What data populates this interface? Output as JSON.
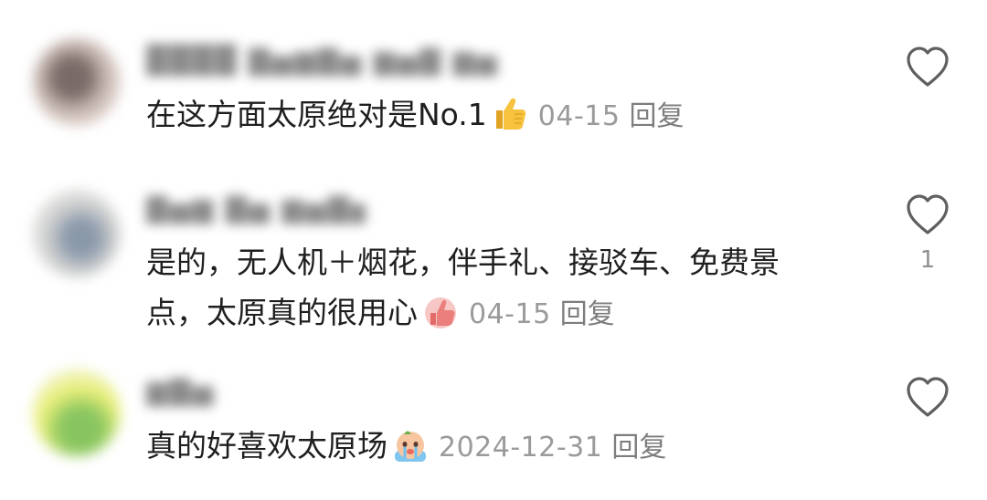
{
  "comments": [
    {
      "username": "████ ▇▅▆▇▅ ▆▅▇ ▆▅",
      "text": "在这方面太原绝对是No.1",
      "emoji": "thumbs-up",
      "date": "04-15",
      "reply_label": "回复",
      "like_count": "",
      "avatar_colors": [
        "#7a6a66",
        "#b9a8a1",
        "#e5d6d0"
      ]
    },
    {
      "username": "▇▅▆ ▇▅ ▆▅▇▅▆",
      "text_line1": "是的，无人机＋烟花，伴手礼、接驳车、免费景",
      "text_line2": "点，太原真的很用心",
      "emoji": "thumbs-up-pink",
      "date": "04-15",
      "reply_label": "回复",
      "like_count": "1",
      "avatar_colors": [
        "#8f98a6",
        "#c7c9c9",
        "#e8e7e3"
      ]
    },
    {
      "username": "▆▇▅",
      "text": "真的好喜欢太原场",
      "emoji": "crying-face",
      "date": "2024-12-31",
      "reply_label": "回复",
      "like_count": "",
      "avatar_colors": [
        "#e8ee6a",
        "#7bbf4f",
        "#eef2c8"
      ]
    }
  ]
}
